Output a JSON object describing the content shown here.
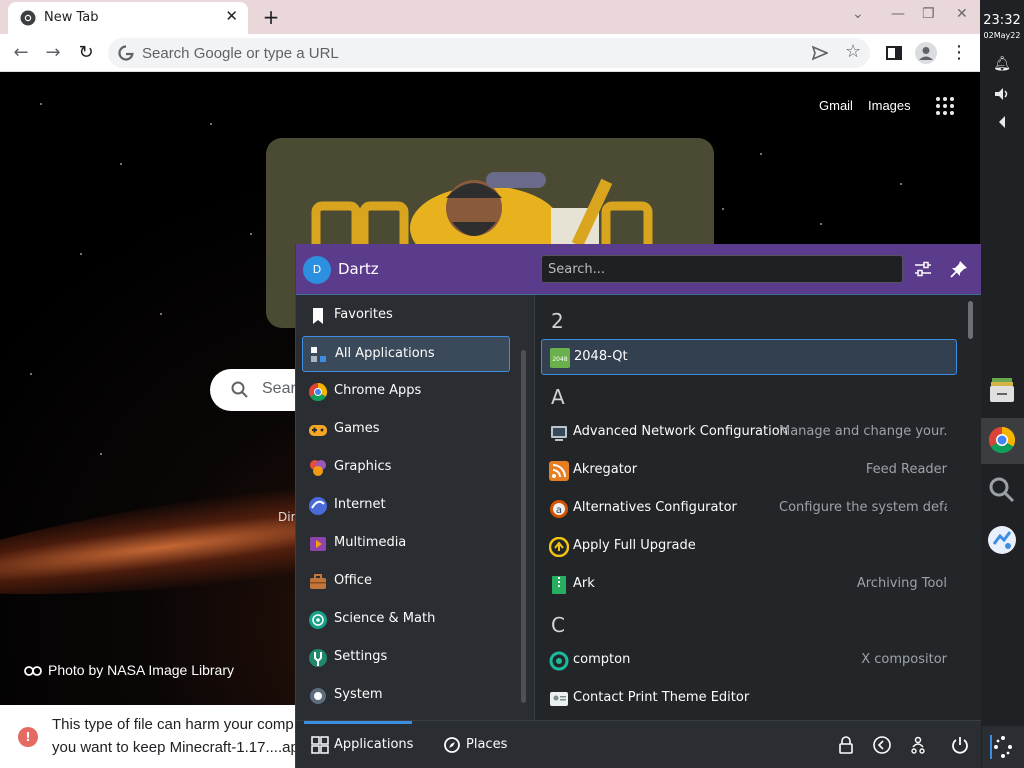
{
  "browser": {
    "tab_title": "New Tab",
    "omnibox_placeholder": "Search Google or type a URL"
  },
  "ntp": {
    "gmail": "Gmail",
    "images": "Images",
    "search_partial": "Sear",
    "dir_partial": "Dir",
    "photo_credit": "Photo by NASA Image Library"
  },
  "download_warning": {
    "line1": "This type of file can harm your comp",
    "line2": "you want to keep Minecraft-1.17....ap"
  },
  "shelf": {
    "time": "23:32",
    "date": "02May22"
  },
  "launcher": {
    "user_initial": "D",
    "user_name": "Dartz",
    "search_placeholder": "Search...",
    "categories": [
      {
        "label": "Favorites",
        "icon": "bookmark-icon"
      },
      {
        "label": "All Applications",
        "icon": "all-apps-icon",
        "selected": true
      },
      {
        "label": "Chrome Apps",
        "icon": "chrome-icon"
      },
      {
        "label": "Games",
        "icon": "gamepad-icon"
      },
      {
        "label": "Graphics",
        "icon": "graphics-icon"
      },
      {
        "label": "Internet",
        "icon": "internet-icon"
      },
      {
        "label": "Multimedia",
        "icon": "multimedia-icon"
      },
      {
        "label": "Office",
        "icon": "briefcase-icon"
      },
      {
        "label": "Science & Math",
        "icon": "science-icon"
      },
      {
        "label": "Settings",
        "icon": "settings-icon"
      },
      {
        "label": "System",
        "icon": "system-icon"
      }
    ],
    "sections": [
      {
        "letter": "2",
        "apps": [
          {
            "name": "2048-Qt",
            "desc": "",
            "icon": "2048-icon",
            "selected": true
          }
        ]
      },
      {
        "letter": "A",
        "apps": [
          {
            "name": "Advanced Network Configuration",
            "desc": "Manage and change your...",
            "icon": "network-icon"
          },
          {
            "name": "Akregator",
            "desc": "Feed Reader",
            "icon": "rss-icon"
          },
          {
            "name": "Alternatives Configurator",
            "desc": "Configure the system default alte...",
            "icon": "alternatives-icon"
          },
          {
            "name": "Apply Full Upgrade",
            "desc": "",
            "icon": "upgrade-icon"
          },
          {
            "name": "Ark",
            "desc": "Archiving Tool",
            "icon": "ark-icon"
          }
        ]
      },
      {
        "letter": "C",
        "apps": [
          {
            "name": "compton",
            "desc": "X compositor",
            "icon": "compton-icon"
          },
          {
            "name": "Contact Print Theme Editor",
            "desc": "",
            "icon": "contact-icon"
          }
        ]
      }
    ],
    "footer": {
      "applications": "Applications",
      "places": "Places"
    }
  },
  "colors": {
    "accent": "#3d8ee0",
    "header": "#5b3b8c",
    "panel": "#2a2e32"
  }
}
